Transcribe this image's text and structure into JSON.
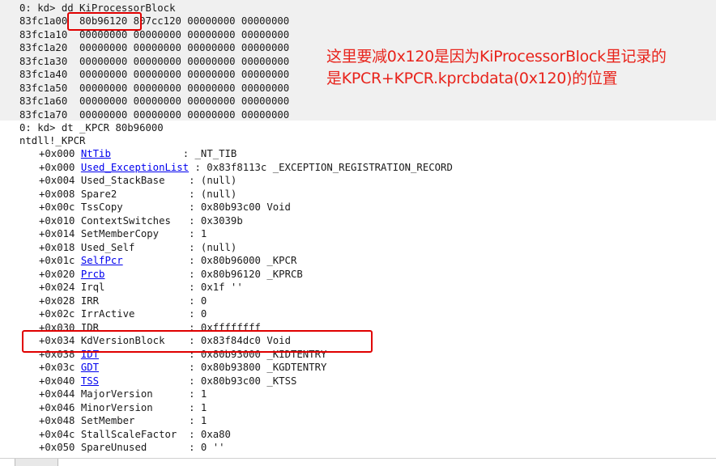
{
  "dd_cmd": "0: kd> dd KiProcessorBlock",
  "dump_rows": [
    "83fc1a00  80b96120 807cc120 00000000 00000000",
    "83fc1a10  00000000 00000000 00000000 00000000",
    "83fc1a20  00000000 00000000 00000000 00000000",
    "83fc1a30  00000000 00000000 00000000 00000000",
    "83fc1a40  00000000 00000000 00000000 00000000",
    "83fc1a50  00000000 00000000 00000000 00000000",
    "83fc1a60  00000000 00000000 00000000 00000000",
    "83fc1a70  00000000 00000000 00000000 00000000"
  ],
  "dt_cmd": "0: kd> dt _KPCR 80b96000",
  "type_name": "ntdll!_KPCR",
  "fields": [
    {
      "off": "+0x000 ",
      "name": "NtTib",
      "pad": "            ",
      "val": ": _NT_TIB",
      "link": true
    },
    {
      "off": "+0x000 ",
      "name": "Used_ExceptionList",
      "pad": " ",
      "val": ": 0x83f8113c _EXCEPTION_REGISTRATION_RECORD",
      "link": true
    },
    {
      "off": "+0x004 ",
      "name": "Used_StackBase",
      "pad": "    ",
      "val": ": (null)",
      "link": false
    },
    {
      "off": "+0x008 ",
      "name": "Spare2",
      "pad": "            ",
      "val": ": (null)",
      "link": false
    },
    {
      "off": "+0x00c ",
      "name": "TssCopy",
      "pad": "           ",
      "val": ": 0x80b93c00 Void",
      "link": false
    },
    {
      "off": "+0x010 ",
      "name": "ContextSwitches",
      "pad": "   ",
      "val": ": 0x3039b",
      "link": false
    },
    {
      "off": "+0x014 ",
      "name": "SetMemberCopy",
      "pad": "     ",
      "val": ": 1",
      "link": false
    },
    {
      "off": "+0x018 ",
      "name": "Used_Self",
      "pad": "         ",
      "val": ": (null)",
      "link": false
    },
    {
      "off": "+0x01c ",
      "name": "SelfPcr",
      "pad": "           ",
      "val": ": 0x80b96000 _KPCR",
      "link": true
    },
    {
      "off": "+0x020 ",
      "name": "Prcb",
      "pad": "              ",
      "val": ": 0x80b96120 _KPRCB",
      "link": true
    },
    {
      "off": "+0x024 ",
      "name": "Irql",
      "pad": "              ",
      "val": ": 0x1f ''",
      "link": false
    },
    {
      "off": "+0x028 ",
      "name": "IRR",
      "pad": "               ",
      "val": ": 0",
      "link": false
    },
    {
      "off": "+0x02c ",
      "name": "IrrActive",
      "pad": "         ",
      "val": ": 0",
      "link": false
    },
    {
      "off": "+0x030 ",
      "name": "IDR",
      "pad": "               ",
      "val": ": 0xffffffff",
      "link": false
    },
    {
      "off": "+0x034 ",
      "name": "KdVersionBlock",
      "pad": "    ",
      "val": ": 0x83f84dc0 Void",
      "link": false
    },
    {
      "off": "+0x038 ",
      "name": "IDT",
      "pad": "               ",
      "val": ": 0x80b93000 _KIDTENTRY",
      "link": true
    },
    {
      "off": "+0x03c ",
      "name": "GDT",
      "pad": "               ",
      "val": ": 0x80b93800 _KGDTENTRY",
      "link": true
    },
    {
      "off": "+0x040 ",
      "name": "TSS",
      "pad": "               ",
      "val": ": 0x80b93c00 _KTSS",
      "link": true
    },
    {
      "off": "+0x044 ",
      "name": "MajorVersion",
      "pad": "      ",
      "val": ": 1",
      "link": false
    },
    {
      "off": "+0x046 ",
      "name": "MinorVersion",
      "pad": "      ",
      "val": ": 1",
      "link": false
    },
    {
      "off": "+0x048 ",
      "name": "SetMember",
      "pad": "         ",
      "val": ": 1",
      "link": false
    },
    {
      "off": "+0x04c ",
      "name": "StallScaleFactor",
      "pad": "  ",
      "val": ": 0xa80",
      "link": false
    },
    {
      "off": "+0x050 ",
      "name": "SpareUnused",
      "pad": "       ",
      "val": ": 0 ''",
      "link": false
    }
  ],
  "annotation_line1": "这里要减0x120是因为KiProcessorBlock里记录的",
  "annotation_line2": "是KPCR+KPCR.kprcbdata(0x120)的位置",
  "colors": {
    "annotation": "#e8231b",
    "highlight_box": "#e00000",
    "link": "#0000ee"
  }
}
